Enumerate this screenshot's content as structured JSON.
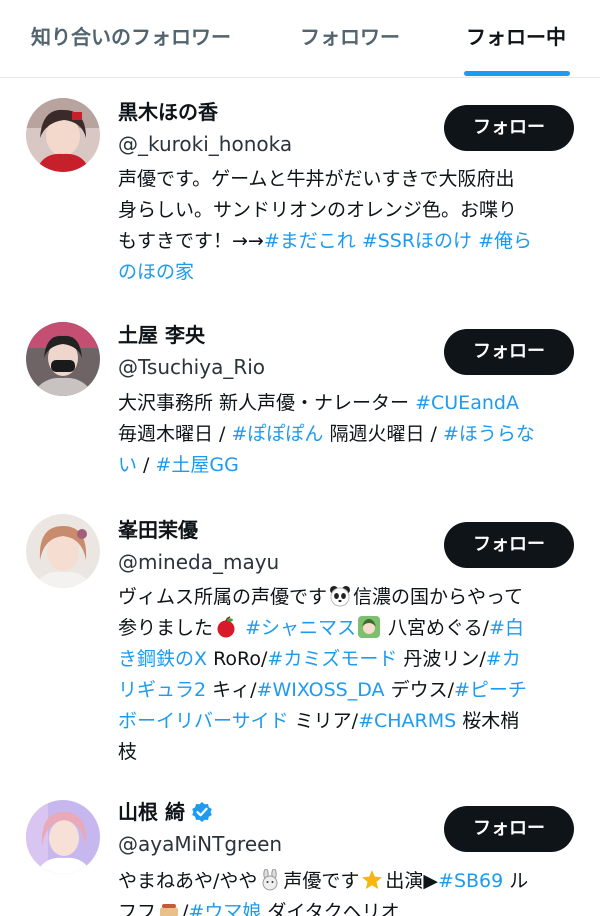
{
  "tabs": [
    {
      "label": "知り合いのフォロワー",
      "active": false
    },
    {
      "label": "フォロワー",
      "active": false
    },
    {
      "label": "フォロー中",
      "active": true
    }
  ],
  "colors": {
    "accent": "#1d9bf0",
    "button_bg": "#0f1419",
    "text": "#0f1419",
    "muted": "#536471"
  },
  "users": [
    {
      "name": "黒木ほの香",
      "handle": "@_kuroki_honoka",
      "button": "フォロー",
      "bio": [
        [
          {
            "t": "声優です。ゲームと牛丼がだいすきで大阪府出"
          }
        ],
        [
          {
            "t": "身らしい。サンドリオンのオレンジ色。お喋り"
          }
        ],
        [
          {
            "t": "もすきです！→→"
          },
          {
            "t": "#まだこれ",
            "tag": true
          },
          {
            "t": " "
          },
          {
            "t": "#SSRほのけ",
            "tag": true
          },
          {
            "t": " "
          },
          {
            "t": "#俺ら",
            "tag": true
          }
        ],
        [
          {
            "t": "のほの家",
            "tag": true
          }
        ]
      ]
    },
    {
      "name": "土屋 李央",
      "handle": "@Tsuchiya_Rio",
      "button": "フォロー",
      "bio": [
        [
          {
            "t": "大沢事務所 新人声優・ナレーター "
          },
          {
            "t": "#CUEandA",
            "tag": true
          }
        ],
        [
          {
            "t": "毎週木曜日 / "
          },
          {
            "t": "#ぽぽぽん",
            "tag": true
          },
          {
            "t": " 隔週火曜日 / "
          },
          {
            "t": "#ほうらな",
            "tag": true
          }
        ],
        [
          {
            "t": "い",
            "tag": true
          },
          {
            "t": " / "
          },
          {
            "t": "#土屋GG",
            "tag": true
          }
        ]
      ]
    },
    {
      "name": "峯田茉優",
      "handle": "@mineda_mayu",
      "button": "フォロー",
      "bio": [
        [
          {
            "t": "ヴィムス所属の声優です"
          },
          {
            "emoji": "panda-emoji"
          },
          {
            "t": "信濃の国からやって"
          }
        ],
        [
          {
            "t": "参りました"
          },
          {
            "emoji": "apple-emoji"
          },
          {
            "t": " "
          },
          {
            "t": "#シャニマス",
            "tag": true
          },
          {
            "emoji": "character-emoji"
          },
          {
            "t": " 八宮めぐる/"
          },
          {
            "t": "#白",
            "tag": true
          }
        ],
        [
          {
            "t": "き鋼鉄のX",
            "tag": true
          },
          {
            "t": " RoRo/"
          },
          {
            "t": "#カミズモード",
            "tag": true
          },
          {
            "t": " 丹波リン/"
          },
          {
            "t": "#カ",
            "tag": true
          }
        ],
        [
          {
            "t": "リギュラ2",
            "tag": true
          },
          {
            "t": " キィ/"
          },
          {
            "t": "#WIXOSS_DA",
            "tag": true
          },
          {
            "t": " デウス/"
          },
          {
            "t": "#ピーチ",
            "tag": true
          }
        ],
        [
          {
            "t": "ボーイリバーサイド",
            "tag": true
          },
          {
            "t": " ミリア/"
          },
          {
            "t": "#CHARMS",
            "tag": true
          },
          {
            "t": " 桜木梢"
          }
        ],
        [
          {
            "t": "枝"
          }
        ]
      ]
    },
    {
      "name": "山根 綺",
      "handle": "@ayaMiNTgreen",
      "button": "フォロー",
      "verified": true,
      "bio": [
        [
          {
            "t": "やまねあや/やや"
          },
          {
            "emoji": "rabbit-emoji"
          },
          {
            "t": "声優です"
          },
          {
            "emoji": "star-emoji"
          },
          {
            "t": "出演▶"
          },
          {
            "t": "#SB69",
            "tag": true
          },
          {
            "t": " ル"
          }
        ],
        [
          {
            "t": "フフ"
          },
          {
            "emoji": "food-emoji"
          },
          {
            "t": "/"
          },
          {
            "t": "#ウマ娘",
            "tag": true
          },
          {
            "t": " ダイタクヘリオ"
          }
        ]
      ]
    }
  ]
}
